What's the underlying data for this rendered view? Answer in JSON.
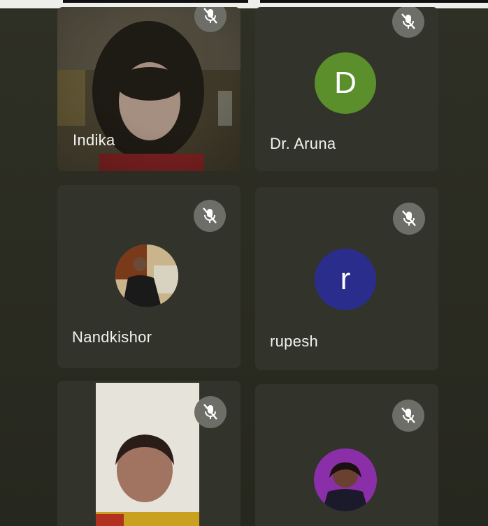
{
  "participants": [
    {
      "name": "Indika",
      "mic": "muted",
      "tile": "video"
    },
    {
      "name": "Dr. Aruna",
      "mic": "muted",
      "avatar_letter": "D",
      "avatar_color": "#5a8f2c"
    },
    {
      "name": "Nandkishor",
      "mic": "muted",
      "tile": "profile-photo"
    },
    {
      "name": "rupesh",
      "mic": "muted",
      "avatar_letter": "r",
      "avatar_color": "#2b2d8c"
    },
    {
      "name": "",
      "mic": "muted",
      "tile": "video"
    },
    {
      "name": "",
      "mic": "muted",
      "tile": "profile-photo"
    }
  ],
  "icons": {
    "mic_off": "mic-off-icon"
  },
  "colors": {
    "background": "#2e2f25",
    "tile": "#32332a",
    "mic_badge": "#6d6e68"
  }
}
